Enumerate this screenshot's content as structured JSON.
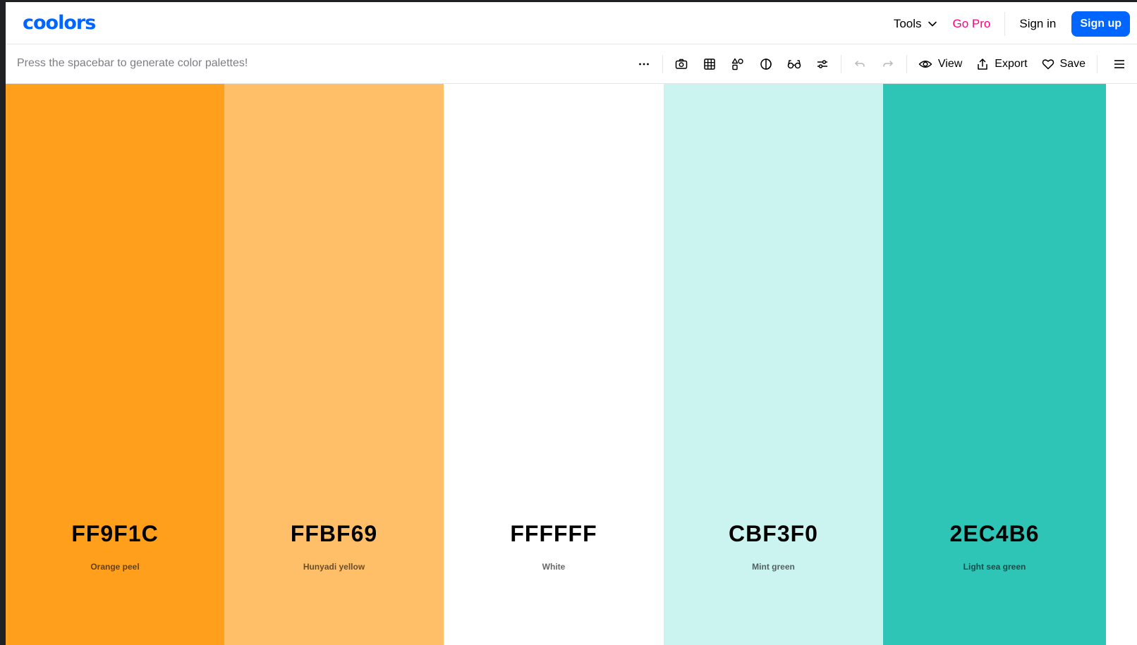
{
  "navbar": {
    "logo": "coolors",
    "tools_label": "Tools",
    "gopro_label": "Go Pro",
    "signin_label": "Sign in",
    "signup_label": "Sign up"
  },
  "toolbar": {
    "hint": "Press the spacebar to generate color palettes!",
    "icons": [
      "more-icon",
      "camera-icon",
      "grid-icon",
      "shapes-icon",
      "contrast-icon",
      "glasses-icon",
      "sliders-icon",
      "undo-icon",
      "redo-icon"
    ],
    "view_label": "View",
    "export_label": "Export",
    "save_label": "Save"
  },
  "palette": [
    {
      "hex": "FF9F1C",
      "name": "Orange peel",
      "color": "#FF9F1C"
    },
    {
      "hex": "FFBF69",
      "name": "Hunyadi yellow",
      "color": "#FFBF69"
    },
    {
      "hex": "FFFFFF",
      "name": "White",
      "color": "#FFFFFF"
    },
    {
      "hex": "CBF3F0",
      "name": "Mint green",
      "color": "#CBF3F0"
    },
    {
      "hex": "2EC4B6",
      "name": "Light sea green",
      "color": "#2EC4B6"
    }
  ],
  "colors": {
    "brand": "#0066ff",
    "gopro": "#ff0080"
  }
}
